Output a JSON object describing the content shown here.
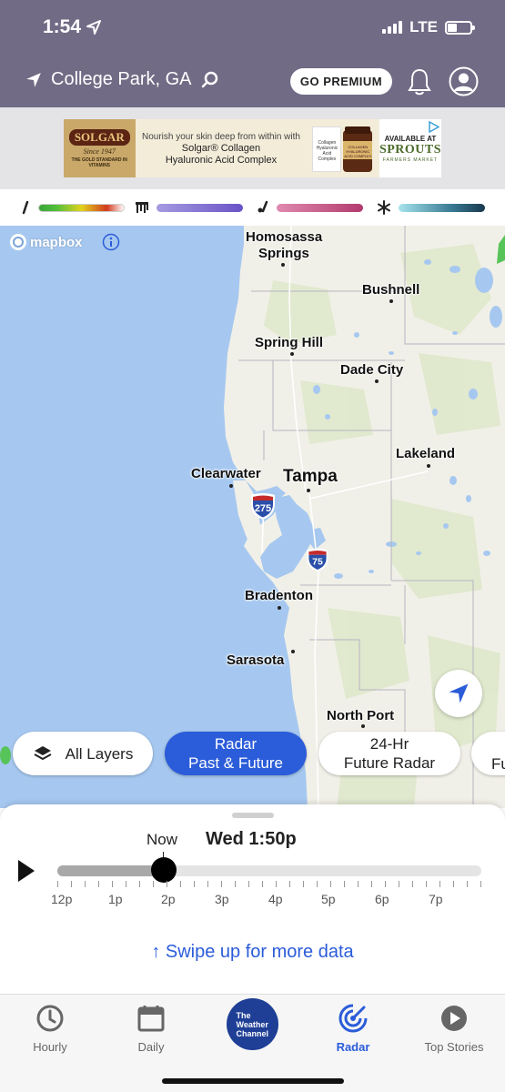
{
  "status_bar": {
    "time": "1:54",
    "network": "LTE",
    "icons": [
      "location-arrow-icon",
      "signal-bars-icon",
      "battery-icon"
    ]
  },
  "header": {
    "location": "College Park, GA",
    "premium_button": "GO PREMIUM",
    "icons": [
      "location-arrow-icon",
      "search-icon",
      "bell-icon",
      "user-avatar-icon"
    ]
  },
  "ad": {
    "brand": "SOLGAR",
    "since": "Since 1947",
    "tagline": "THE GOLD STANDARD IN VITAMINS",
    "line1": "Nourish your skin deep from within with",
    "line2": "Solgar® Collagen",
    "line3": "Hyaluronic Acid Complex",
    "box_text": "Collagen Hyaluronic Acid Complex",
    "jar_text": "COLLAGEN HYALURONIC ACID COMPLEX",
    "available": "AVAILABLE AT",
    "store": "SPROUTS",
    "store_sub": "FARMERS MARKET"
  },
  "legend": [
    {
      "icon": "rain-icon",
      "gradient": [
        "#3aa53a",
        "#e2d21e",
        "#d23a1e",
        "#ffffff"
      ]
    },
    {
      "icon": "ice-icon",
      "gradient": [
        "#a59be0",
        "#6a52c8"
      ]
    },
    {
      "icon": "mix-icon",
      "gradient": [
        "#e08ab0",
        "#b23a6e"
      ]
    },
    {
      "icon": "snowflake-icon",
      "gradient": [
        "#a6e4ec",
        "#17384e"
      ]
    }
  ],
  "map": {
    "attribution": "mapbox",
    "cities": [
      {
        "name": "Homosassa",
        "name2": "Springs"
      },
      {
        "name": "Bushnell"
      },
      {
        "name": "Spring Hill"
      },
      {
        "name": "Dade City"
      },
      {
        "name": "Lakeland"
      },
      {
        "name": "Clearwater"
      },
      {
        "name": "Tampa"
      },
      {
        "name": "Bradenton"
      },
      {
        "name": "Sarasota"
      },
      {
        "name": "North Port"
      }
    ],
    "highways": [
      "275",
      "75"
    ]
  },
  "layers": {
    "all_layers": "All Layers",
    "radar_line1": "Radar",
    "radar_line2": "Past & Future",
    "future_line1": "24-Hr",
    "future_line2": "Future Radar",
    "next_partial": "Fu"
  },
  "timeline": {
    "now_label": "Now",
    "current_time": "Wed 1:50p",
    "progress": 0.25,
    "hour_labels": [
      "12p",
      "1p",
      "2p",
      "3p",
      "4p",
      "5p",
      "6p",
      "7p"
    ],
    "swipe_hint": "↑ Swipe up for more data"
  },
  "tabs": [
    {
      "label": "Hourly",
      "icon": "clock-icon"
    },
    {
      "label": "Daily",
      "icon": "calendar-icon"
    },
    {
      "label": "The Weather Channel",
      "icon": "twc-logo"
    },
    {
      "label": "Radar",
      "icon": "radar-icon"
    },
    {
      "label": "Top Stories",
      "icon": "play-circle-icon"
    }
  ],
  "colors": {
    "header_bg": "#716b85",
    "accent_blue": "#2b5cd9",
    "water": "#a6c8f0",
    "land": "#f1f0e8"
  }
}
